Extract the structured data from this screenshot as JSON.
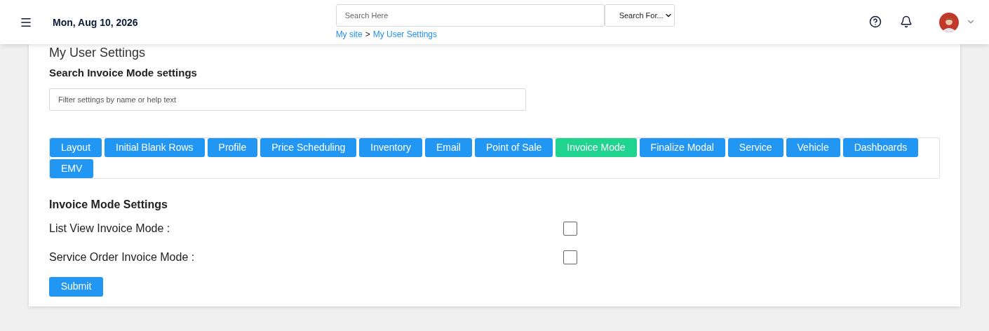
{
  "header": {
    "date": "Mon, Aug 10, 2026",
    "search": {
      "placeholder": "Search Here"
    },
    "search_for": {
      "value": "Search For..."
    },
    "breadcrumb": [
      {
        "label": "My site"
      },
      {
        "label": "My User Settings"
      }
    ],
    "breadcrumb_separator": ">"
  },
  "page_title": "My User Settings",
  "search_section": {
    "heading": "Search Invoice Mode settings",
    "filter": {
      "placeholder": "Filter settings by name or help text"
    }
  },
  "tabs": [
    {
      "label": "Layout",
      "selected": false
    },
    {
      "label": "Initial Blank Rows",
      "selected": false
    },
    {
      "label": "Profile",
      "selected": false
    },
    {
      "label": "Price Scheduling",
      "selected": false
    },
    {
      "label": "Inventory",
      "selected": false
    },
    {
      "label": "Email",
      "selected": false
    },
    {
      "label": "Point of Sale",
      "selected": false
    },
    {
      "label": "Invoice Mode",
      "selected": true
    },
    {
      "label": "Finalize Modal",
      "selected": false
    },
    {
      "label": "Service",
      "selected": false
    },
    {
      "label": "Vehicle",
      "selected": false
    },
    {
      "label": "Dashboards",
      "selected": false
    },
    {
      "label": "EMV",
      "selected": false
    }
  ],
  "settings": {
    "heading": "Invoice Mode Settings",
    "items": [
      {
        "label": "List View Invoice Mode :",
        "checked": false
      },
      {
        "label": "Service Order Invoice Mode :",
        "checked": false
      }
    ]
  },
  "submit": "Submit"
}
